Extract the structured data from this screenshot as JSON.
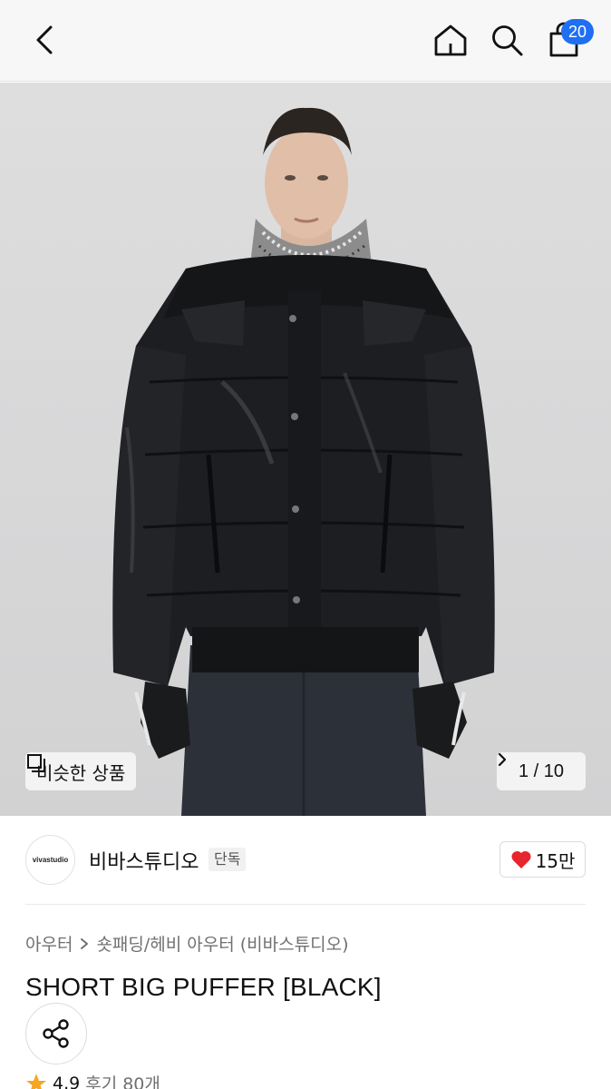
{
  "header": {
    "cart_count": "20",
    "icons": [
      "chevron-left-icon",
      "home-icon",
      "search-icon",
      "shopping-bag-icon"
    ]
  },
  "gallery": {
    "similar_label": "비슷한 상품",
    "pager": "1 / 10"
  },
  "brand": {
    "logo_text": "vivastudio",
    "name": "비바스튜디오",
    "tag": "단독",
    "likes": "15만"
  },
  "breadcrumb": {
    "items": [
      "아우터",
      "숏패딩/헤비 아우터 (비바스튜디오)"
    ]
  },
  "product": {
    "title": "SHORT BIG PUFFER [BLACK]"
  },
  "rating": {
    "score": "4.9",
    "reviews": "후기 80개"
  },
  "colors": {
    "badge": "#1f6ff2",
    "heart": "#e8242e",
    "star": "#f5a623"
  }
}
